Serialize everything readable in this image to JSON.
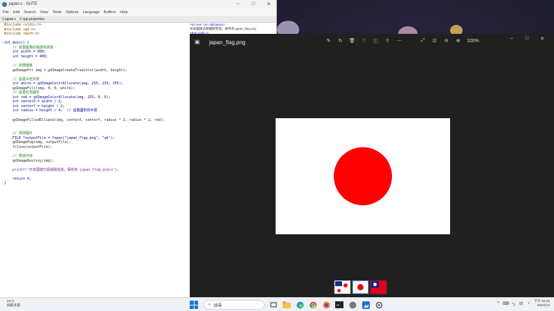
{
  "editor": {
    "title": "japan.c - SciTE",
    "menu": [
      "File",
      "Edit",
      "Search",
      "View",
      "Tools",
      "Options",
      "Language",
      "Buffers",
      "Help"
    ],
    "tabs": [
      "1 japan.c",
      "2 cpp.properties"
    ],
    "code_lines": [
      "#include <stdio.h>",
      "#include <gd.h>",
      "#include <math.h>",
      "",
      "int main() {",
      "    // 設置圖像的寬度和高度",
      "    int width = 600;",
      "    int height = 400;",
      "",
      "    // 創建圖像",
      "    gdImagePtr img = gdImageCreateTrueColor(width, height);",
      "",
      "    // 設置白色背景",
      "    int white = gdImageColorAllocate(img, 255, 255, 255);",
      "    gdImageFill(img, 0, 0, white);",
      "    // 設置紅色圓形",
      "    int red = gdImageColorAllocate(img, 255, 0, 0);",
      "    int centerX = width / 2;",
      "    int centerY = height / 2;",
      "    int radius = height / 4;  // 設置圓形的半徑",
      "",
      "    gdImageFilledEllipse(img, centerX, centerY, radius * 2, radius * 2, red);",
      "",
      "",
      "    // 保存圖片",
      "    FILE *outputFile = fopen(\"japan_flag.png\", \"wb\");",
      "    gdImagePng(img, outputFile);",
      "    fclose(outputFile);",
      "",
      "    // 釋放內存",
      "    gdImageDestroy(img);",
      "",
      "    printf(\"日本國旗已經繪製完成，保存為 japan_flag.png\\n\");",
      "",
      "    return 0;",
      "}"
    ],
    "output_lines": [
      ">tcc.exe -run -lgd japan.c",
      "日本國旗已經繪製完成，保存為 japan_flag.png",
      ">Exit code: 0"
    ]
  },
  "viewer": {
    "filename": "japan_flag.png",
    "zoom": "100%",
    "tool_icons": [
      "edit-icon",
      "rotate-icon",
      "delete-icon",
      "favorite-icon",
      "info-icon",
      "share-icon",
      "more-icon"
    ],
    "flag_colors": {
      "background": "#ffffff",
      "circle": "#ff0000"
    },
    "thumbnails": [
      "thumbnail-mixed-flag",
      "thumbnail-japan-flag",
      "thumbnail-taiwan-flag"
    ]
  },
  "taskbar": {
    "weather_temp": "23°C",
    "weather_text": "局部多雲",
    "search_placeholder": "搜尋",
    "time": "下午 02:25",
    "date": "2024/1/3"
  }
}
